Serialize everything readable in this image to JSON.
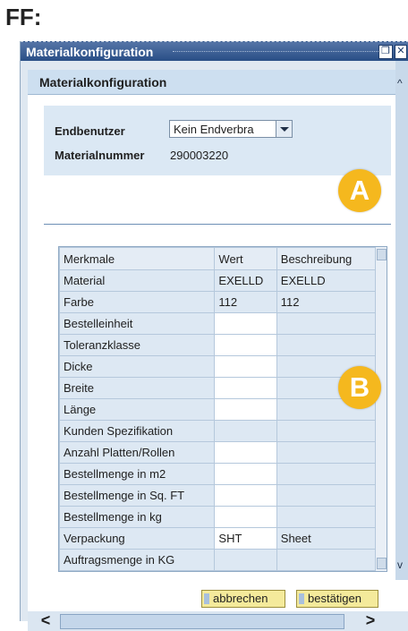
{
  "page_label": "FF:",
  "window": {
    "title": "Materialkonfiguration",
    "buttons": {
      "restore": "❐",
      "close": "✕"
    }
  },
  "panel": {
    "header": "Materialkonfiguration"
  },
  "form": {
    "endbenutzer_label": "Endbenutzer",
    "endbenutzer_value": "Kein Endverbra",
    "materialnummer_label": "Materialnummer",
    "materialnummer_value": "290003220"
  },
  "badges": {
    "a": "A",
    "b": "B"
  },
  "table": {
    "headers": [
      "Merkmale",
      "Wert",
      "Beschreibung"
    ],
    "rows": [
      {
        "merkmal": "Material",
        "wert": "EXELLD",
        "beschreibung": "EXELLD",
        "input": false
      },
      {
        "merkmal": "Farbe",
        "wert": "112",
        "beschreibung": "112",
        "input": false
      },
      {
        "merkmal": "Bestelleinheit",
        "wert": "",
        "beschreibung": "",
        "input": true
      },
      {
        "merkmal": "Toleranzklasse",
        "wert": "",
        "beschreibung": "",
        "input": true
      },
      {
        "merkmal": "Dicke",
        "wert": "",
        "beschreibung": "",
        "input": true
      },
      {
        "merkmal": "Breite",
        "wert": "",
        "beschreibung": "",
        "input": true
      },
      {
        "merkmal": "Länge",
        "wert": "",
        "beschreibung": "",
        "input": true
      },
      {
        "merkmal": "Kunden Spezifikation",
        "wert": "",
        "beschreibung": "",
        "input": false
      },
      {
        "merkmal": "Anzahl Platten/Rollen",
        "wert": "",
        "beschreibung": "",
        "input": true
      },
      {
        "merkmal": "Bestellmenge in m2",
        "wert": "",
        "beschreibung": "",
        "input": true
      },
      {
        "merkmal": "Bestellmenge in Sq. FT",
        "wert": "",
        "beschreibung": "",
        "input": true
      },
      {
        "merkmal": "Bestellmenge in kg",
        "wert": "",
        "beschreibung": "",
        "input": true
      },
      {
        "merkmal": "Verpackung",
        "wert": "SHT",
        "beschreibung": "Sheet",
        "input": true
      },
      {
        "merkmal": "Auftragsmenge in KG",
        "wert": "",
        "beschreibung": "",
        "input": false
      }
    ]
  },
  "actions": {
    "cancel": "abbrechen",
    "confirm": "bestätigen"
  },
  "scroll": {
    "left": "<",
    "right": ">"
  },
  "colors": {
    "titlebar": "#294e86",
    "badge": "#f5b81e",
    "button": "#f4ea9b",
    "panel_bg": "#dbe8f4"
  }
}
